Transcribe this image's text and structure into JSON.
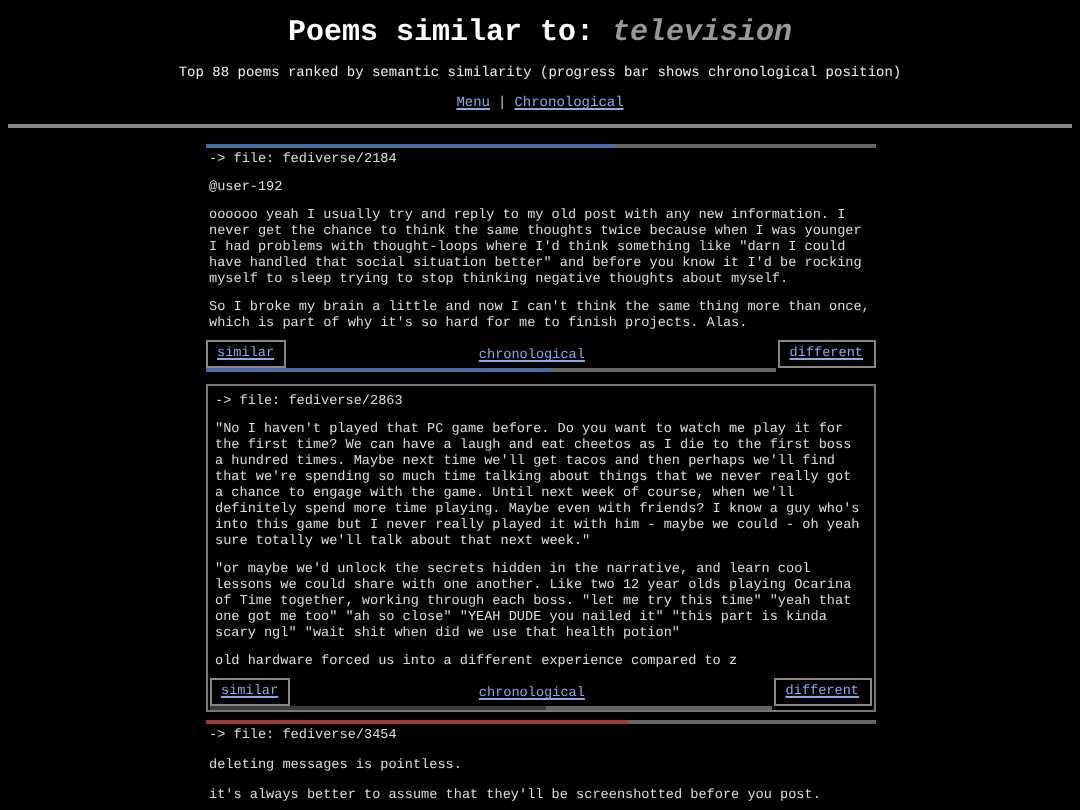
{
  "header": {
    "title": "Poems similar to:",
    "query": "television",
    "subtitle": "Top 88 poems ranked by semantic similarity (progress bar shows chronological position)",
    "links": [
      {
        "label": "Menu"
      },
      {
        "label": "Chronological"
      }
    ],
    "separator": "|"
  },
  "posts": [
    {
      "file": "-> file: fediverse/2184",
      "highlighted": false,
      "level": 0.61,
      "color": "#4a6ea8",
      "user": "@user-192",
      "paragraphs": [
        "oooooo yeah I usually try and reply to my old post with any new information. I never get the chance to think the same thoughts twice because when I was younger I had problems with thought-loops where I'd think something like \"darn I could have handled that social situation better\" and before you know it I'd be rocking myself to sleep trying to stop thinking negative thoughts about myself.",
        "So I broke my brain a little and now I can't think the same thing more than once, which is part of why it's so hard for me to finish projects. Alas."
      ],
      "nav": {
        "similar": "similar",
        "chronological": "chronological",
        "different": "different"
      }
    },
    {
      "file": "-> file: fediverse/2863",
      "highlighted": true,
      "level": 0.6,
      "color": "#3a3a3a",
      "paragraphs": [
        "\"No I haven't played that PC game before. Do you want to watch me play it for the first time? We can have a laugh and eat cheetos as I die to the first boss a hundred times. Maybe next time we'll get tacos and then perhaps we'll find that we're spending so much time talking about things that we never really got a chance to engage with the game. Until next week of course, when we'll definitely spend more time playing. Maybe even with friends? I know a guy who's into this game but I never really played it with him - maybe we could - oh yeah sure totally we'll talk about that next week.\"",
        "\"or maybe we'd unlock the secrets hidden in the narrative, and learn cool lessons we could share with one another. Like two 12 year olds playing Ocarina of Time together, working through each boss. \"let me try this time\" \"yeah that one got me too\" \"ah so close\" \"YEAH DUDE you nailed it\" \"this part is kinda scary ngl\" \"wait shit when did we use that health potion\"",
        "old hardware forced us into a different experience compared to z"
      ],
      "nav": {
        "similar": "similar",
        "chronological": "chronological",
        "different": "different"
      }
    },
    {
      "file": "-> file: fediverse/3454",
      "highlighted": false,
      "level": 0.63,
      "color": "#9c3a3a",
      "paragraphs": [
        "deleting messages is pointless.",
        "it's always better to assume that they'll be screenshotted before you post."
      ]
    }
  ]
}
